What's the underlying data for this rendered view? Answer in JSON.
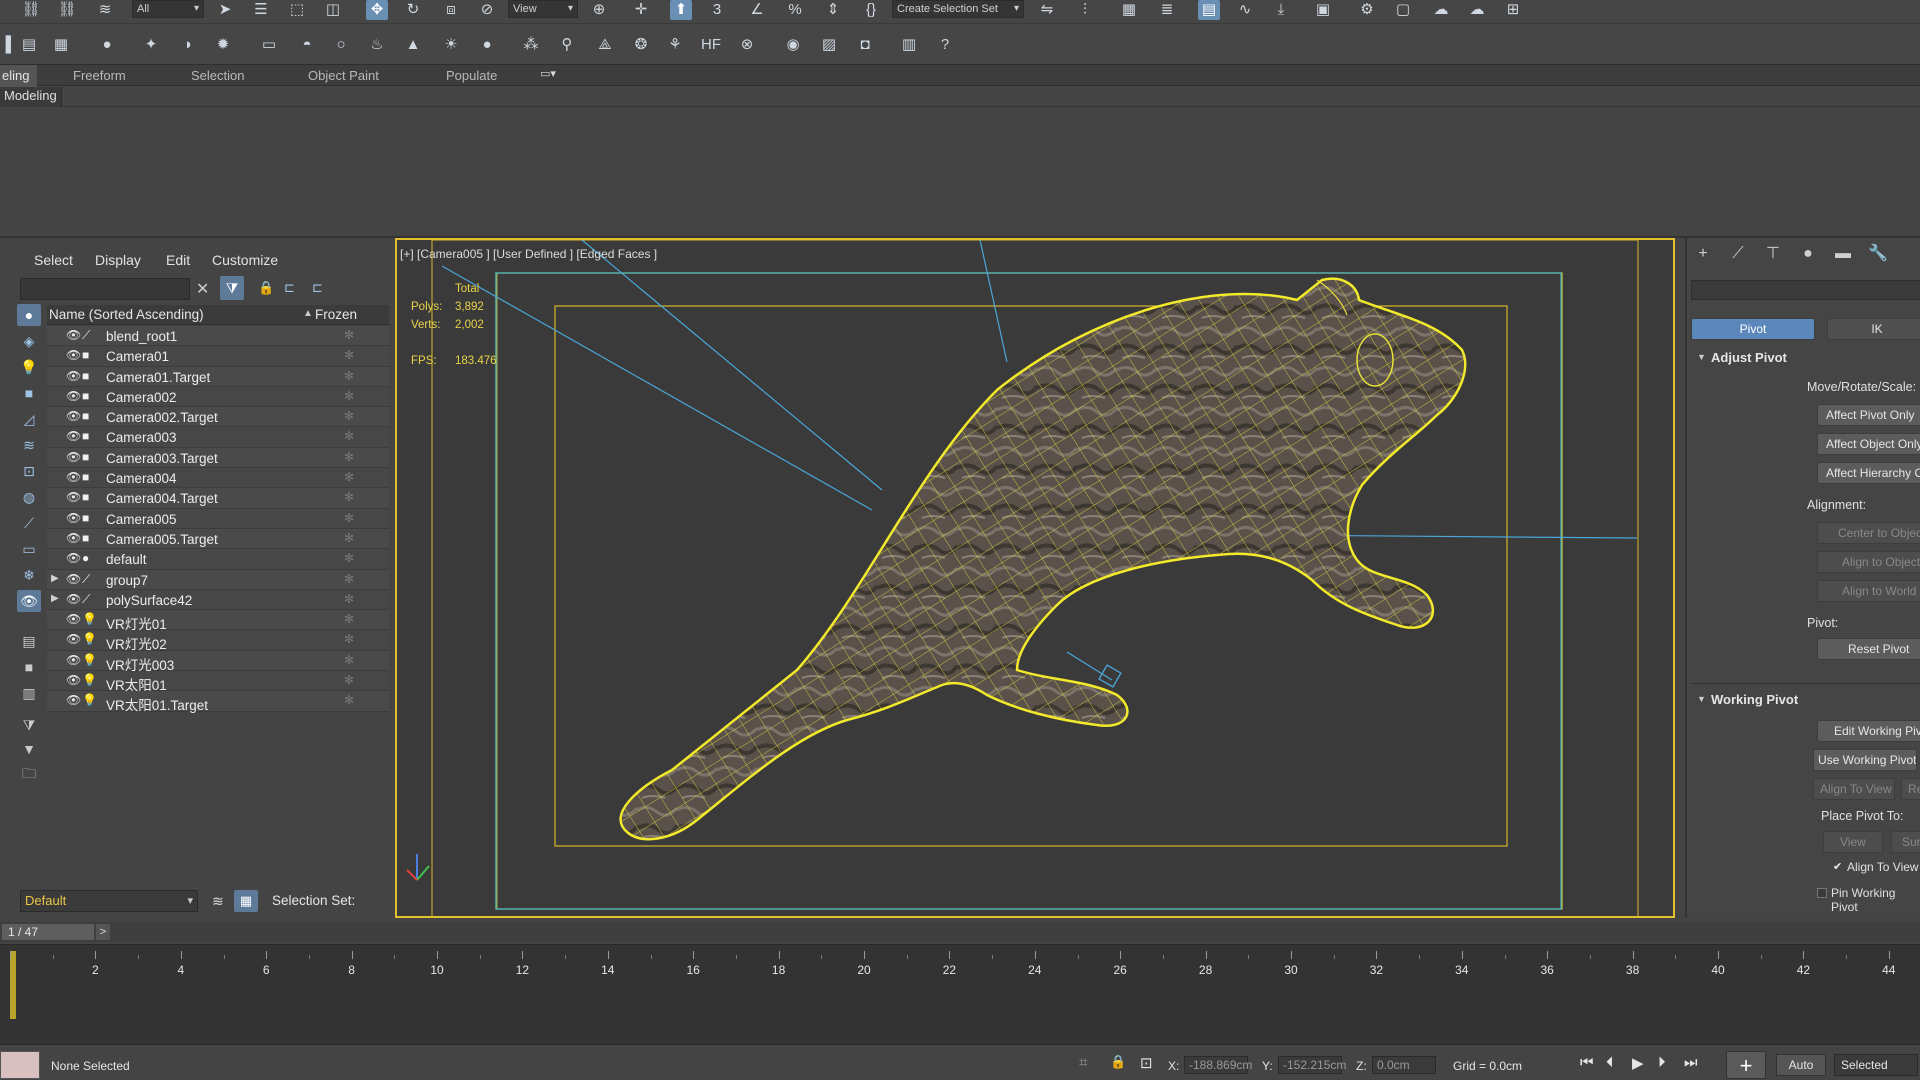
{
  "toolbar_main": {
    "selection_filter": "All",
    "view_dropdown": "View",
    "selection_set_dropdown": "Create Selection Set"
  },
  "ribbon": {
    "tabs": [
      "eling",
      "Freeform",
      "Selection",
      "Object Paint",
      "Populate"
    ],
    "active_subtab": "Modeling"
  },
  "explorer": {
    "menu": [
      "Select",
      "Display",
      "Edit",
      "Customize"
    ],
    "search_value": "",
    "col_name": "Name (Sorted Ascending)",
    "col_sort": "▲",
    "col_frozen": "Frozen",
    "rows": [
      {
        "name": "blend_root1",
        "icon": "bone",
        "expander": ""
      },
      {
        "name": "Camera01",
        "icon": "camera",
        "expander": ""
      },
      {
        "name": "Camera01.Target",
        "icon": "camera",
        "expander": ""
      },
      {
        "name": "Camera002",
        "icon": "camera",
        "expander": ""
      },
      {
        "name": "Camera002.Target",
        "icon": "camera",
        "expander": ""
      },
      {
        "name": "Camera003",
        "icon": "camera",
        "expander": ""
      },
      {
        "name": "Camera003.Target",
        "icon": "camera",
        "expander": ""
      },
      {
        "name": "Camera004",
        "icon": "camera",
        "expander": ""
      },
      {
        "name": "Camera004.Target",
        "icon": "camera",
        "expander": ""
      },
      {
        "name": "Camera005",
        "icon": "camera",
        "expander": ""
      },
      {
        "name": "Camera005.Target",
        "icon": "camera",
        "expander": ""
      },
      {
        "name": "default",
        "icon": "sphere",
        "expander": ""
      },
      {
        "name": "group7",
        "icon": "bone",
        "expander": "▶"
      },
      {
        "name": "polySurface42",
        "icon": "bone",
        "expander": "▶"
      },
      {
        "name": "VR灯光01",
        "icon": "light",
        "expander": ""
      },
      {
        "name": "VR灯光02",
        "icon": "light",
        "expander": ""
      },
      {
        "name": "VR灯光003",
        "icon": "light",
        "expander": ""
      },
      {
        "name": "VR太阳01",
        "icon": "light",
        "expander": ""
      },
      {
        "name": "VR太阳01.Target",
        "icon": "light",
        "expander": ""
      }
    ],
    "layer_value": "Default",
    "selection_set_label": "Selection Set:"
  },
  "viewport": {
    "label": "[+] [Camera005 ] [User Defined ] [Edged Faces ]",
    "stats_header": "Total",
    "polys_label": "Polys:",
    "polys_value": "3,892",
    "verts_label": "Verts:",
    "verts_value": "2,002",
    "fps_label": "FPS:",
    "fps_value": "183.476",
    "wire_color": "#e8e03a",
    "selection_color": "#f2ea2a",
    "safe_frame_color": "#3fb8c8"
  },
  "command_panel": {
    "tab_pivot": "Pivot",
    "tab_ik": "IK",
    "adjust_pivot": "Adjust Pivot",
    "move_rotate_scale": "Move/Rotate/Scale:",
    "affect_pivot_only": "Affect Pivot Only",
    "affect_object_only": "Affect Object Only",
    "affect_hierarchy_only": "Affect Hierarchy Only",
    "alignment": "Alignment:",
    "center_to_object": "Center to Object",
    "align_to_object": "Align to Object",
    "align_to_world": "Align to World",
    "pivot": "Pivot:",
    "reset_pivot": "Reset Pivot",
    "working_pivot": "Working Pivot",
    "edit_working_pivot": "Edit Working Pivot",
    "use_working_pivot": "Use Working Pivot",
    "align_to_view": "Align To View",
    "reset": "Reset",
    "place_pivot_to": "Place Pivot To:",
    "view": "View",
    "surface": "Surface",
    "align_to_view_check": "Align To View",
    "pin_working_pivot": "Pin Working Pivot"
  },
  "timeline": {
    "frame_indicator": "1 / 47",
    "next_label": ">",
    "tick_labels": [
      "2",
      "4",
      "6",
      "8",
      "10",
      "12",
      "14",
      "16",
      "18",
      "20",
      "22",
      "24",
      "26",
      "28",
      "30",
      "32",
      "34",
      "36",
      "38",
      "40",
      "42",
      "44"
    ]
  },
  "status": {
    "message": "None Selected",
    "x_label": "X:",
    "x_value": "-188.869cm",
    "y_label": "Y:",
    "y_value": "-152.215cm",
    "z_label": "Z:",
    "z_value": "0.0cm",
    "grid": "Grid = 0.0cm",
    "auto_key": "Auto Key",
    "key_mode": "Selected"
  }
}
